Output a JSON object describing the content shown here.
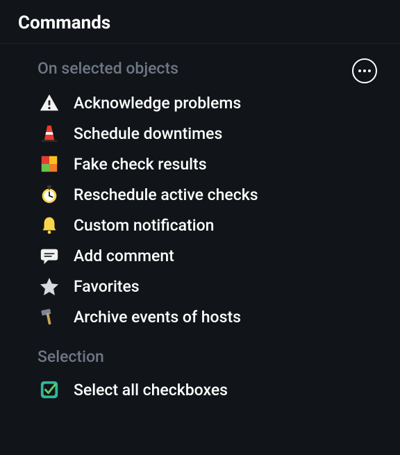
{
  "header": {
    "title": "Commands"
  },
  "section1": {
    "title": "On selected objects",
    "items": [
      {
        "label": "Acknowledge problems"
      },
      {
        "label": "Schedule downtimes"
      },
      {
        "label": "Fake check results"
      },
      {
        "label": "Reschedule active checks"
      },
      {
        "label": "Custom notification"
      },
      {
        "label": "Add comment"
      },
      {
        "label": "Favorites"
      },
      {
        "label": "Archive events of hosts"
      }
    ]
  },
  "section2": {
    "title": "Selection",
    "items": [
      {
        "label": "Select all checkboxes"
      }
    ]
  }
}
